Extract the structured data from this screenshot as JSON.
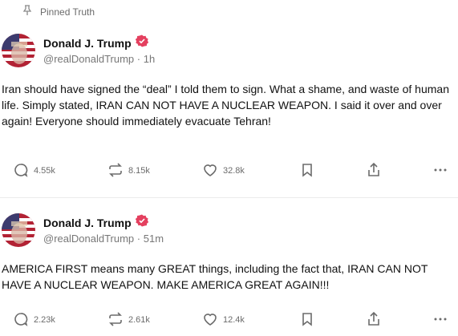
{
  "pinned": {
    "label": "Pinned Truth"
  },
  "posts": [
    {
      "author": {
        "name": "Donald J. Trump",
        "handle": "@realDonaldTrump",
        "time": "1h"
      },
      "text": "Iran should have signed the “deal” I told them to sign. What a shame, and waste of human life. Simply stated, IRAN CAN NOT HAVE A NUCLEAR WEAPON. I said it over and over again! Everyone should immediately evacuate Tehran!",
      "stats": {
        "replies": "4.55k",
        "retruths": "8.15k",
        "likes": "32.8k"
      }
    },
    {
      "author": {
        "name": "Donald J. Trump",
        "handle": "@realDonaldTrump",
        "time": "51m"
      },
      "text": "AMERICA FIRST means many GREAT things, including the fact that, IRAN CAN NOT HAVE A NUCLEAR WEAPON. MAKE AMERICA GREAT AGAIN!!!",
      "stats": {
        "replies": "2.23k",
        "retruths": "2.61k",
        "likes": "12.4k"
      }
    }
  ],
  "colors": {
    "verified": "#e4405f",
    "muted": "#6b6b6b",
    "text": "#111111"
  },
  "icons": [
    "pin-icon",
    "verified-icon",
    "reply-icon",
    "retruth-icon",
    "like-icon",
    "bookmark-icon",
    "share-icon",
    "more-icon"
  ]
}
